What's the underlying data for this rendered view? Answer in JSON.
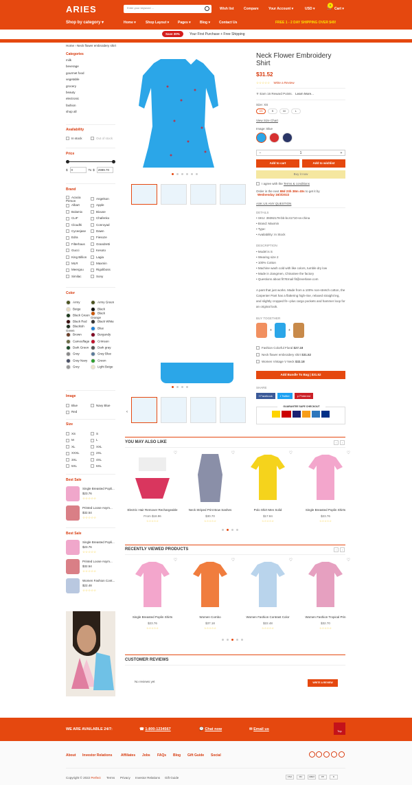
{
  "header": {
    "logo": "ARIES",
    "search_placeholder": "Enter your keyword ...",
    "wishlist": "Wish list",
    "compare": "Compare",
    "account": "Your Account",
    "currency": "USD",
    "cart_label": "Cart",
    "cart_count": "0",
    "shop_by_category": "Shop by category",
    "nav": [
      "Home",
      "Shop Layout",
      "Pages",
      "Blog",
      "Contact Us"
    ],
    "shipping": "FREE 1 - 2 DAY SHIPPING OVER $49!"
  },
  "promo": {
    "badge": "Save 30%",
    "text": "Your First Purchase + Free Shipping"
  },
  "breadcrumb": {
    "home": "Home",
    "current": "Neck flower embroidery shirt"
  },
  "sidebar": {
    "categories_title": "Categories",
    "categories": [
      "milk",
      "beverage",
      "gourmet food",
      "vegetable",
      "grocery",
      "beauty",
      "electronic",
      "fashion",
      "shop all"
    ],
    "availability_title": "Availability",
    "availability": [
      "In stock",
      "Out of stock"
    ],
    "price_title": "Price",
    "price_from": "0",
    "price_to": "2999.70",
    "price_currency": "$",
    "price_to_label": "To",
    "brand_title": "Brand",
    "brands_left": [
      "Acacia Person",
      "Albart",
      "Bolamix",
      "CLIF",
      "Cloudhi",
      "Cyceejase",
      "Edra",
      "Filterhaus",
      "Gucci",
      "King Billion",
      "MLR",
      "Meergou",
      "Similac"
    ],
    "brands_right": [
      "Angelson",
      "Apple",
      "Biouse",
      "Chafenko",
      "Conroyad",
      "Dawn",
      "Fiesoze",
      "Grandretti",
      "Kesoto",
      "Lagia",
      "Maxmin",
      "Rigoliboss",
      "Sony"
    ],
    "color_title": "Color",
    "colors_left": [
      "Army",
      "Beige",
      "Black Green",
      "Black Red",
      "Blackish Green",
      "Brown",
      "Camouflage",
      "Dark Green",
      "Gray",
      "Gray Navy",
      "Grey"
    ],
    "colors_left_hex": [
      "#4b5320",
      "#e8dcc4",
      "#1c3a1c",
      "#3a0f0f",
      "#203020",
      "#6b3e26",
      "#6b6b45",
      "#1f4d2b",
      "#888888",
      "#4a5066",
      "#999999"
    ],
    "colors_right": [
      "Army Green",
      "Black",
      "Black Orange",
      "Black White",
      "Blue",
      "Burgundy",
      "Crimson",
      "Dark gray",
      "Gray Blue",
      "Green",
      "Light Beige"
    ],
    "colors_right_hex": [
      "#4b5320",
      "#111111",
      "#cc5500",
      "#333333",
      "#1e7fd6",
      "#800020",
      "#c0102a",
      "#555555",
      "#5a7a9a",
      "#2e9e2e",
      "#efe3cc"
    ],
    "image_title": "Image",
    "images_left": [
      "Blue",
      "Red"
    ],
    "images_right": [
      "Navy Blue"
    ],
    "size_title": "Size",
    "sizes_left": [
      "XS",
      "M",
      "XL",
      "XXXL",
      "3XL",
      "5XL"
    ],
    "sizes_right": [
      "S",
      "L",
      "XXL",
      "2XL",
      "4XL",
      "6XL"
    ],
    "bestsale_title": "Best Sale",
    "bestsale1": [
      {
        "name": "Single Breasted Popli...",
        "price": "$23.76"
      },
      {
        "name": "Printed Loose Asym...",
        "price": "$32.54"
      }
    ],
    "bestsale2": [
      {
        "name": "Single Breasted Popli...",
        "price": "$23.76"
      },
      {
        "name": "Printed Loose Asym...",
        "price": "$32.54"
      },
      {
        "name": "Women Fashion Cont...",
        "price": "$22.48"
      }
    ]
  },
  "product": {
    "title": "Neck Flower Embroidery Shirt",
    "price": "$31.52",
    "write_review": "Write a Review",
    "reward": "Earn 16 Reward Points.",
    "learn_more": "Learn More...",
    "size_label": "Size: XS",
    "sizes": [
      "XS",
      "S",
      "M",
      "L"
    ],
    "size_chart": "View Size Chart",
    "image_label": "Image: Blue",
    "qty": "1",
    "add_to_cart": "Add to cart",
    "add_to_wishlist": "Add to wishlist",
    "buy_it_now": "Buy it now",
    "agree": "I agree with the",
    "terms": "Terms & conditions",
    "order_text": "Order in the next",
    "countdown": "88d 23h 38m 40s",
    "order_text2": "to get it by",
    "delivery_date": "Wednesday 16/3/2022",
    "ask": "ASK US ANY QUESTION",
    "details_title": "DETAILS",
    "details": [
      "SKU: 39392178-bb-bc41710-ss-china",
      "Brand: Maxmin",
      "Type:",
      "Availability: In Stock"
    ],
    "description_title": "DESCRIPTION",
    "description_list": [
      "Model is S",
      "Wearing size 2",
      "100% Cotton",
      "Machine wash cold with like colors, tumble dry low",
      "Made in Jiangmen, ChinaSee the factory",
      "Questions about fit?Email fit@everlane.com"
    ],
    "description_para": "A pant that just works. Made from a 100% non-stretch cotton, the Carpenter Pant has a flattering high-rise, relaxed straight leg, and slightly cropped fit—plus cargo pockets and hammer loop for an original look.",
    "buy_together_title": "BUY TOGETHER",
    "bundle": [
      {
        "name": "Fashion Colorful Floral",
        "price": "$27.18"
      },
      {
        "name": "Neck flower embroidery shirt",
        "price": "$31.52"
      },
      {
        "name": "Women Vintage V Neck",
        "price": "$32.18"
      }
    ],
    "bundle_button": "Add Bundle To Bag | $31.52",
    "share_title": "SHARE",
    "share": [
      "Facebook",
      "Twitter",
      "Pinterest"
    ],
    "checkout_title": "GUARANTEE SAFE CHECKOUT"
  },
  "also_like": {
    "title": "YOU MAY ALSO LIKE",
    "items": [
      {
        "name": "Electric Hair Remover Rechargeable",
        "price": "From $18.96"
      },
      {
        "name": "Neck Striped Print Bow Sashes",
        "price": "$30.70"
      },
      {
        "name": "Polo Shirt Men Solid",
        "price": "$17.84"
      },
      {
        "name": "Single Breasted Poplin Shirts",
        "price": "$23.76"
      }
    ]
  },
  "recent": {
    "title": "RECENTLY VIEWED PRODUCTS",
    "items": [
      {
        "name": "Single Breasted Poplin Shirts",
        "price": "$23.76"
      },
      {
        "name": "Women Combo",
        "price": "$37.18"
      },
      {
        "name": "Women Fashion Contrast Color",
        "price": "$22.48"
      },
      {
        "name": "Women Fashion Tropical Prin",
        "price": "$32.70"
      }
    ]
  },
  "reviews": {
    "title": "CUSTOMER REVIEWS",
    "empty": "No reviews yet",
    "write": "WRITE A REVIEW"
  },
  "footer": {
    "available": "WE ARE AVAILABLE 24/7:",
    "phone": "1-800-1234567",
    "chat": "Chat now",
    "email": "Email us",
    "top": "Top",
    "links": [
      "About",
      "Investor Relations",
      "Affiliates",
      "Jobs",
      "FAQs",
      "Blog",
      "Gift Guide",
      "Social"
    ],
    "copyright": "Copyright © 2022",
    "brand_name": "Perfect",
    "bottom_links": [
      "Terms",
      "Privacy",
      "Investor Relations",
      "Gift Guide"
    ],
    "payments": [
      "VISA",
      "MC",
      "AMEX",
      "PP",
      "D"
    ]
  },
  "colors": {
    "accent": "#e5480f",
    "dark_accent": "#d7390c",
    "product_blue": "#2ba6e8"
  }
}
